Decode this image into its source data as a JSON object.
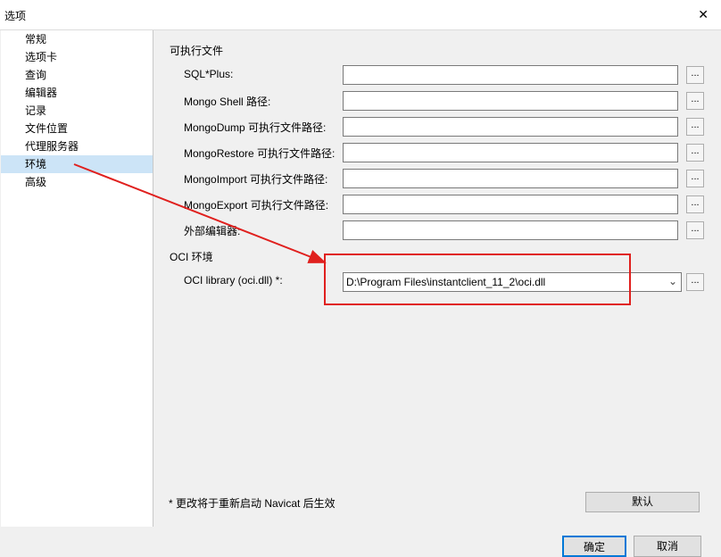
{
  "window": {
    "title": "选项",
    "close_symbol": "✕"
  },
  "sidebar": {
    "items": [
      {
        "label": "常规"
      },
      {
        "label": "选项卡"
      },
      {
        "label": "查询"
      },
      {
        "label": "编辑器"
      },
      {
        "label": "记录"
      },
      {
        "label": "文件位置"
      },
      {
        "label": "代理服务器"
      },
      {
        "label": "环境",
        "selected": true
      },
      {
        "label": "高级"
      }
    ]
  },
  "main": {
    "exec_section": "可执行文件",
    "fields": [
      {
        "label": "SQL*Plus:",
        "value": ""
      },
      {
        "label": "Mongo Shell 路径:",
        "value": ""
      },
      {
        "label": "MongoDump 可执行文件路径:",
        "value": ""
      },
      {
        "label": "MongoRestore 可执行文件路径:",
        "value": ""
      },
      {
        "label": "MongoImport 可执行文件路径:",
        "value": ""
      },
      {
        "label": "MongoExport 可执行文件路径:",
        "value": ""
      },
      {
        "label": "外部编辑器:",
        "value": ""
      }
    ],
    "browse_label": "...",
    "oci_section": "OCI 环境",
    "oci_label": "OCI library (oci.dll) *:",
    "oci_value": "D:\\Program Files\\instantclient_11_2\\oci.dll",
    "note": "* 更改将于重新启动 Navicat 后生效",
    "default_button": "默认"
  },
  "footer": {
    "ok_button": "确定",
    "cancel_button": "取消"
  },
  "annotation": {
    "color": "#e0201e"
  }
}
